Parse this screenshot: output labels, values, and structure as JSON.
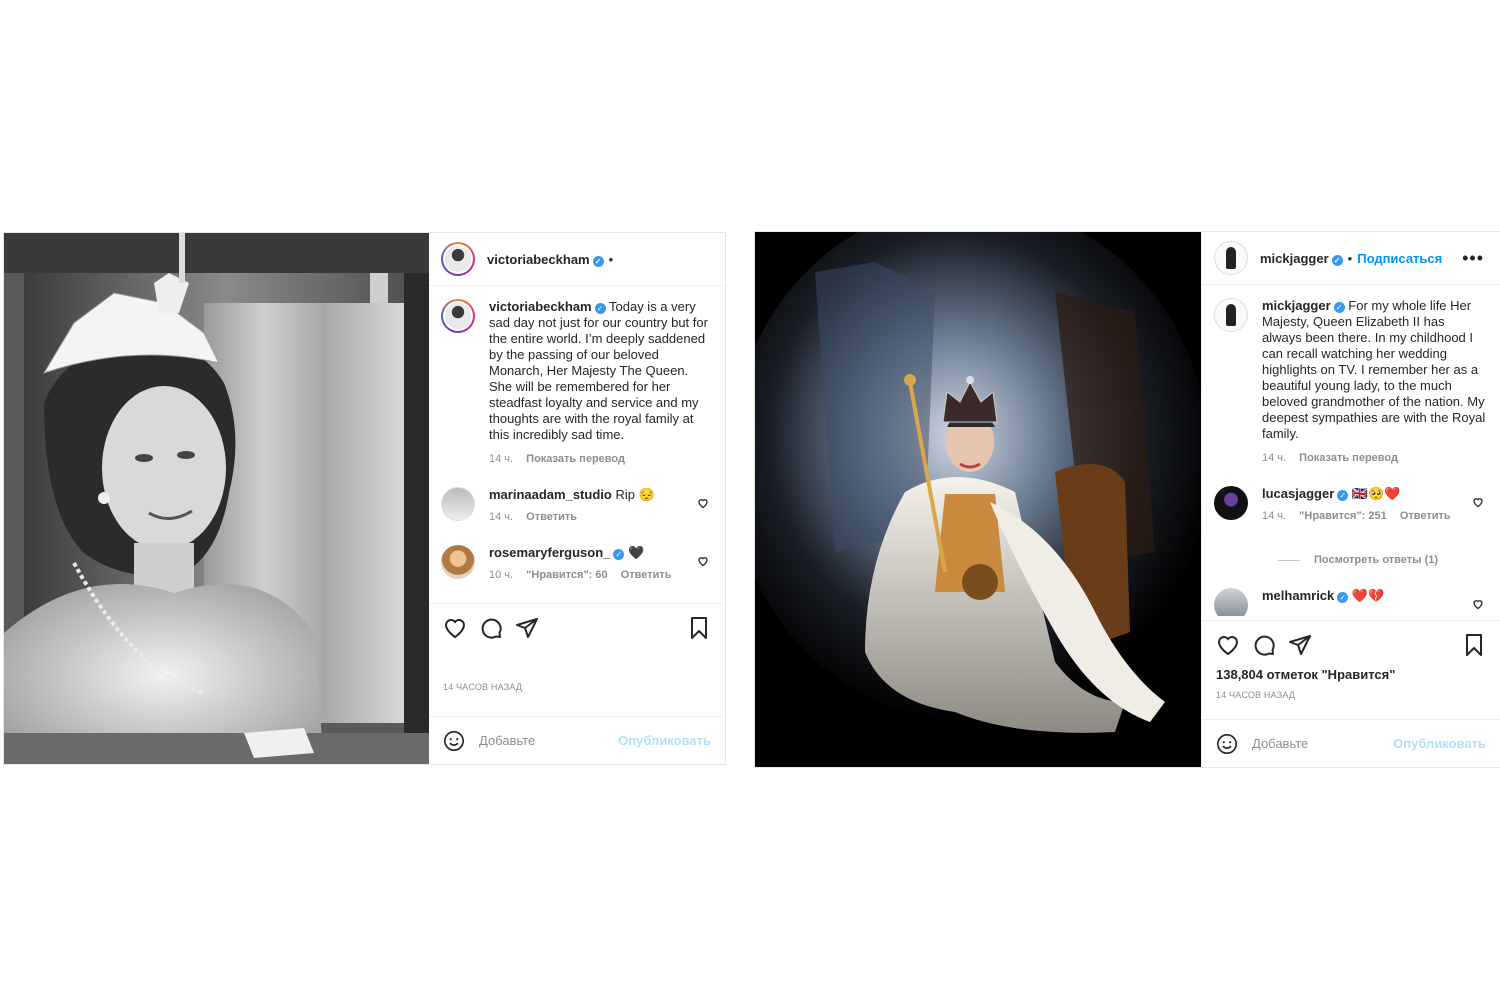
{
  "post1": {
    "username": "victoriabeckham",
    "header_dot": "•",
    "caption": "Today is a very sad day not just for our country but for the entire world. I’m deeply saddened by the passing of our beloved Monarch, Her Majesty The Queen. She will be remembered for her steadfast loyalty and service and my thoughts are with the royal family at this incredibly sad time.",
    "caption_time": "14 ч.",
    "show_translation": "Показать перевод",
    "comments": [
      {
        "username": "marinaadam_studio",
        "text": "Rip 😔",
        "time": "14 ч.",
        "reply": "Ответить"
      },
      {
        "username": "rosemaryferguson_",
        "text": "🖤",
        "time": "10 ч.",
        "likes": "\"Нравится\": 60",
        "reply": "Ответить"
      }
    ],
    "posted_ago": "14 ЧАСОВ НАЗАД",
    "add_comment_placeholder": "Добавьте",
    "publish": "Опубликовать"
  },
  "post2": {
    "username": "mickjagger",
    "header_dot": "•",
    "follow": "Подписаться",
    "more": "•••",
    "caption": "For my whole life Her Majesty, Queen Elizabeth II has always been there. In my childhood I can recall watching her wedding highlights on TV. I remember her as a beautiful young lady, to the much beloved grandmother of the nation. My deepest sympathies are with the Royal family.",
    "caption_time": "14 ч.",
    "show_translation": "Показать перевод",
    "comments": [
      {
        "username": "lucasjagger",
        "text": "🇬🇧🥺❤️",
        "time": "14 ч.",
        "likes": "\"Нравится\": 251",
        "reply": "Ответить"
      },
      {
        "username": "melhamrick",
        "text": "❤️💔"
      }
    ],
    "view_replies": "Посмотреть ответы (1)",
    "likes_total": "138,804 отметок \"Нравится\"",
    "posted_ago": "14 ЧАСОВ НАЗАД",
    "add_comment_placeholder": "Добавьте",
    "publish": "Опубликовать"
  },
  "colors": {
    "link_blue": "#0095f6",
    "publish_disabled": "#b2dffc",
    "muted": "#8e8e8e",
    "verified": "#3897f0"
  },
  "icons": [
    "heart-icon",
    "comment-icon",
    "share-icon",
    "bookmark-icon",
    "emoji-icon",
    "verified-badge-icon",
    "more-options-icon"
  ]
}
